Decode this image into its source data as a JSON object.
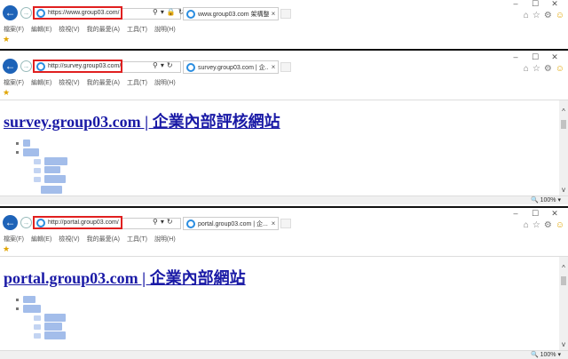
{
  "windows": [
    {
      "url": "https://www.group03.com/",
      "addr_tools": [
        "⚲",
        "▾",
        "🔒",
        "↻"
      ],
      "tab_title": "www.group03.com 架構整...",
      "page_title": "",
      "zoom": ""
    },
    {
      "url": "http://survey.group03.com/",
      "addr_tools": [
        "⚲",
        "▾",
        "↻"
      ],
      "tab_title": "survey.group03.com | 企...",
      "page_title": "survey.group03.com | 企業內部評核網站",
      "zoom": "100%"
    },
    {
      "url": "http://portal.group03.com/",
      "addr_tools": [
        "⚲",
        "▾",
        "↻"
      ],
      "tab_title": "portal.group03.com | 企...",
      "page_title": "portal.group03.com | 企業內部網站",
      "zoom": "100%"
    }
  ],
  "menu": [
    "檔案(F)",
    "編輯(E)",
    "檢視(V)",
    "我的最愛(A)",
    "工具(T)",
    "說明(H)"
  ],
  "window_controls": [
    "–",
    "☐",
    "✕"
  ],
  "toolbar_icons": [
    "home-icon",
    "star-icon",
    "gear-icon",
    "smiley-icon"
  ],
  "tab_close": "×",
  "zoom_icon": "🔍",
  "zoom_dropdown": "▾",
  "colors": {
    "accent_blue": "#1e63b8",
    "highlight_red": "#e02020",
    "link": "#1a1aa6"
  }
}
